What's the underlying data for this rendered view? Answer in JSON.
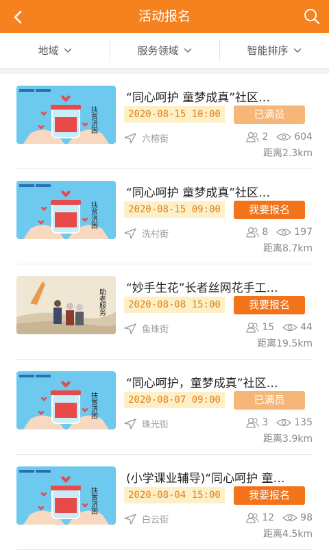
{
  "header": {
    "title": "活动报名",
    "back_icon": "chevron-left-icon",
    "search_icon": "search-icon",
    "background": "#f5821f"
  },
  "filters": [
    {
      "label": "地域"
    },
    {
      "label": "服务领域"
    },
    {
      "label": "智能排序"
    }
  ],
  "colors": {
    "accent": "#f2731a",
    "full_button": "#f5b677",
    "date_bg": "#fdf0c6",
    "date_text": "#e07f1c"
  },
  "activities": [
    {
      "title": "“同心呵护 童梦成真”社区…",
      "datetime": "2020-08-15 10:00",
      "button": "已满员",
      "status": "full",
      "location": "六榕街",
      "participants": "2",
      "views": "604",
      "distance": "距离2.3km",
      "image": "charity-jar",
      "image_caption": "扶贫济困"
    },
    {
      "title": "“同心呵护 童梦成真”社区…",
      "datetime": "2020-08-15 09:00",
      "button": "我要报名",
      "status": "open",
      "location": "洗村街",
      "participants": "8",
      "views": "197",
      "distance": "距离8.7km",
      "image": "charity-jar",
      "image_caption": "扶贫济困"
    },
    {
      "title": "“妙手生花”长者丝网花手工…",
      "datetime": "2020-08-08 15:00",
      "button": "我要报名",
      "status": "open",
      "location": "鱼珠街",
      "participants": "15",
      "views": "44",
      "distance": "距离19.5km",
      "image": "elderly-walk",
      "image_caption": "助老服务"
    },
    {
      "title": "“同心呵护，童梦成真”社区…",
      "datetime": "2020-08-07 09:00",
      "button": "已满员",
      "status": "full",
      "location": "珠光街",
      "participants": "3",
      "views": "135",
      "distance": "距离3.9km",
      "image": "charity-jar",
      "image_caption": "扶贫济困"
    },
    {
      "title": "(小学课业辅导)“同心呵护 童…",
      "datetime": "2020-08-04 15:00",
      "button": "我要报名",
      "status": "open",
      "location": "白云街",
      "participants": "12",
      "views": "98",
      "distance": "距离4.5km",
      "image": "charity-jar",
      "image_caption": "扶贫济困"
    }
  ]
}
